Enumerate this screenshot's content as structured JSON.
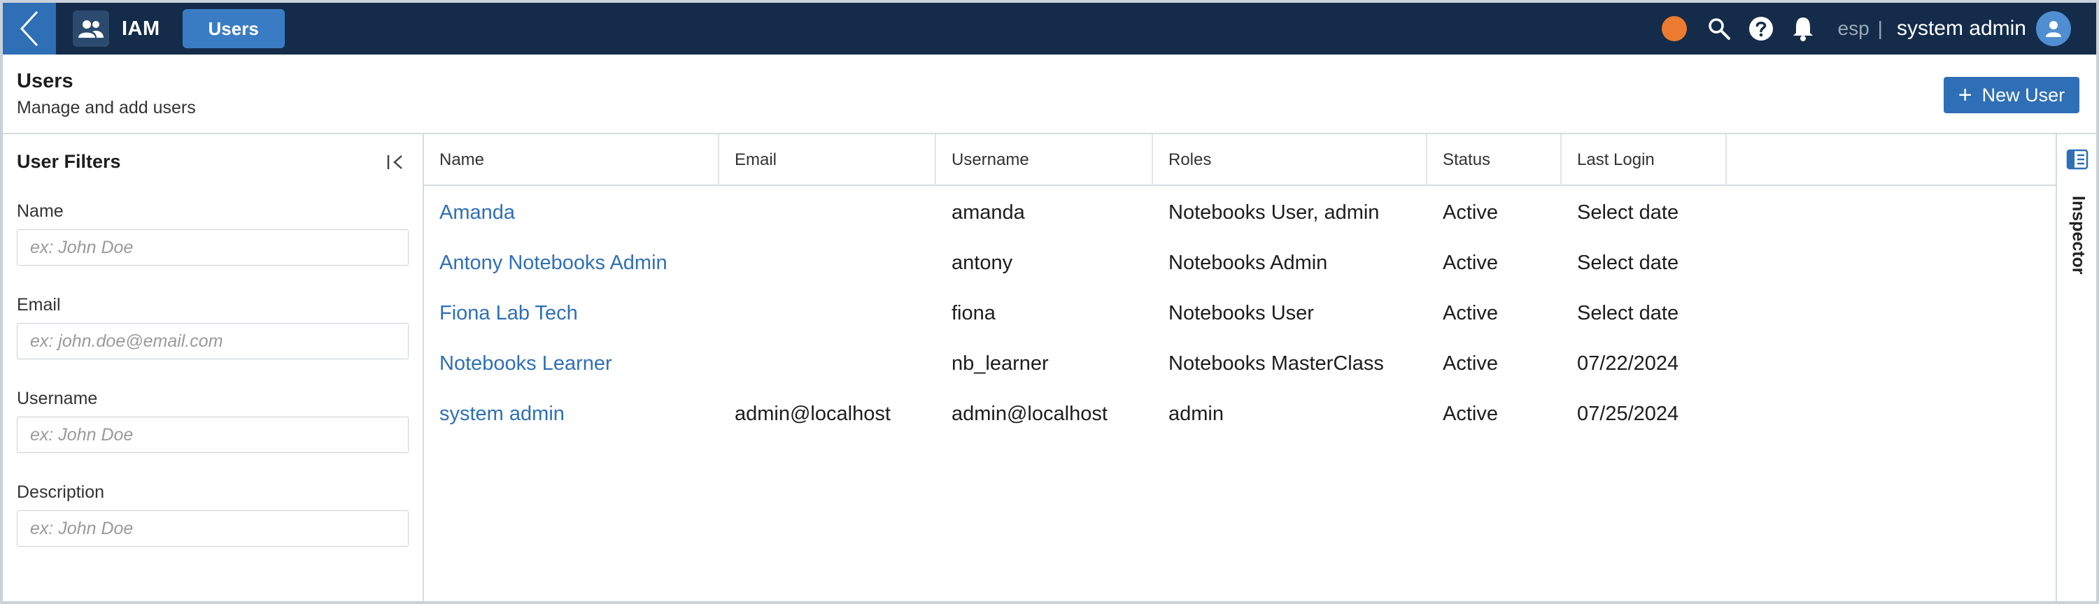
{
  "topbar": {
    "app_name": "IAM",
    "active_tab": "Users",
    "language": "esp",
    "separator": "|",
    "user_name": "system admin",
    "colors": {
      "bar": "#142c4a",
      "accent": "#2f6fb6",
      "status_dot": "#ec7a31"
    },
    "icons": [
      "chevron-left-icon",
      "users-icon",
      "search-icon",
      "help-icon",
      "bell-icon",
      "user-avatar-icon"
    ]
  },
  "header": {
    "title": "Users",
    "subtitle": "Manage and add users",
    "new_user_label": "New User"
  },
  "filters": {
    "title": "User Filters",
    "fields": [
      {
        "label": "Name",
        "placeholder": "ex: John Doe"
      },
      {
        "label": "Email",
        "placeholder": "ex: john.doe@email.com"
      },
      {
        "label": "Username",
        "placeholder": "ex: John Doe"
      },
      {
        "label": "Description",
        "placeholder": "ex: John Doe"
      }
    ]
  },
  "table": {
    "columns": [
      "Name",
      "Email",
      "Username",
      "Roles",
      "Status",
      "Last Login"
    ],
    "rows": [
      {
        "name": "Amanda",
        "email": "",
        "username": "amanda",
        "roles": "Notebooks User, admin",
        "status": "Active",
        "last_login": "Select date"
      },
      {
        "name": "Antony Notebooks Admin",
        "email": "",
        "username": "antony",
        "roles": "Notebooks Admin",
        "status": "Active",
        "last_login": "Select date"
      },
      {
        "name": "Fiona Lab Tech",
        "email": "",
        "username": "fiona",
        "roles": "Notebooks User",
        "status": "Active",
        "last_login": "Select date"
      },
      {
        "name": "Notebooks Learner",
        "email": "",
        "username": "nb_learner",
        "roles": "Notebooks MasterClass",
        "status": "Active",
        "last_login": "07/22/2024"
      },
      {
        "name": "system admin",
        "email": "admin@localhost",
        "username": "admin@localhost",
        "roles": "admin",
        "status": "Active",
        "last_login": "07/25/2024"
      }
    ]
  },
  "inspector": {
    "label": "Inspector"
  }
}
